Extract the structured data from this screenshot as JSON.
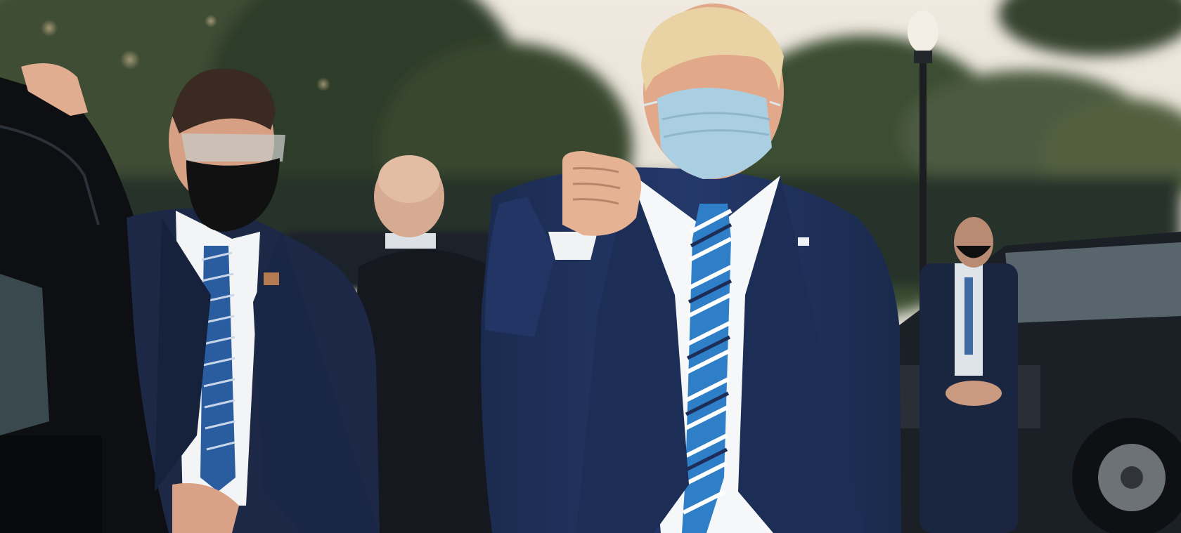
{
  "image": {
    "kind": "photograph",
    "subject": "outdoor-evening-scene",
    "colors": {
      "sky": "#e9e4dc",
      "trees": "#3b4a34",
      "suit_navy": "#1f3158",
      "suit_dark": "#1a2233",
      "shirt": "#f4f5f7",
      "tie_blue": "#2e7cc6",
      "tie_navy": "#1c2e58",
      "mask_blue": "#a9cde0",
      "mask_black": "#111111",
      "vehicle": "#15181d",
      "skin": "#e2ab8e",
      "hair_blond": "#e6cf9c"
    }
  }
}
